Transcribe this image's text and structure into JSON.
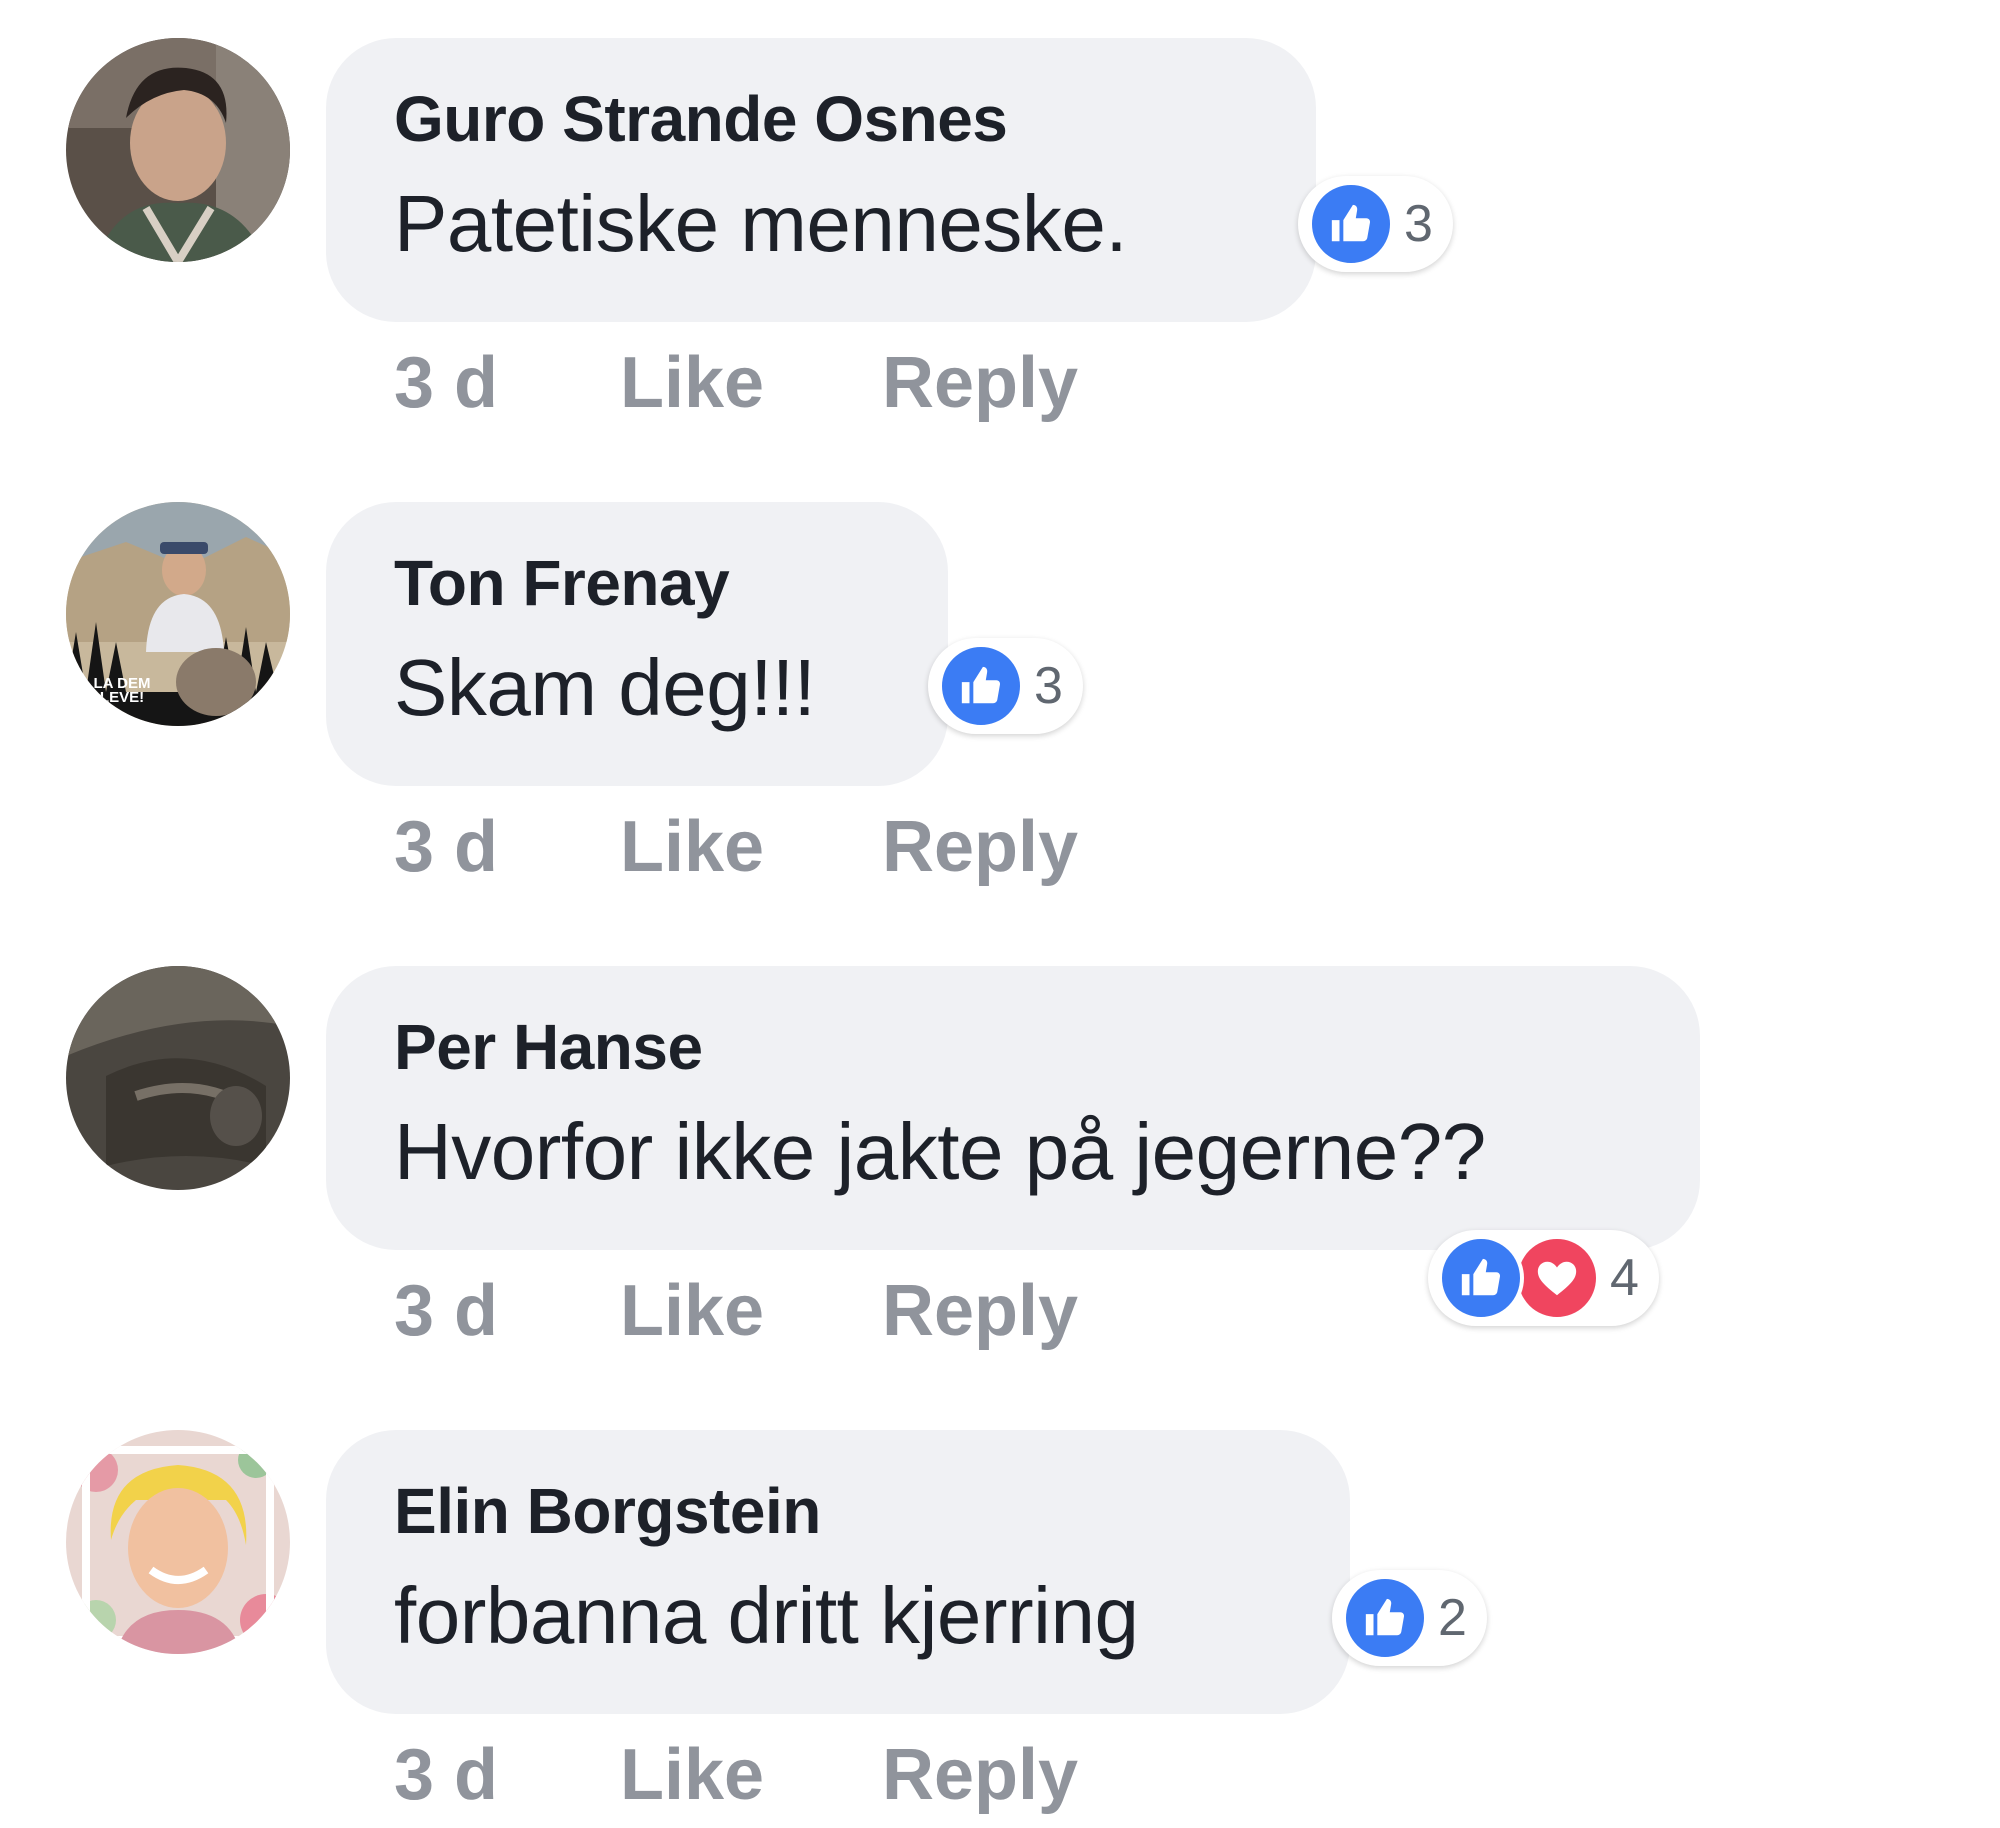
{
  "colors": {
    "bubble": "#f0f1f4",
    "author_text": "#1d2129",
    "meta_text": "#90949c",
    "like_blue": "#3b7cf4",
    "love_red": "#f0455f"
  },
  "comments": [
    {
      "author": "Guro Strande Osnes",
      "text": "Patetiske menneske.",
      "time": "3 d",
      "like_label": "Like",
      "reply_label": "Reply",
      "reactions": {
        "types": [
          "like-icon"
        ],
        "count": "3"
      }
    },
    {
      "author": "Ton Frenay",
      "text": "Skam deg!!!",
      "time": "3 d",
      "like_label": "Like",
      "reply_label": "Reply",
      "avatar_caption": "LA DEM LEVE!",
      "reactions": {
        "types": [
          "like-icon"
        ],
        "count": "3"
      }
    },
    {
      "author": "Per Hanse",
      "text": "Hvorfor ikke jakte på jegerne??",
      "time": "3 d",
      "like_label": "Like",
      "reply_label": "Reply",
      "reactions": {
        "types": [
          "like-icon",
          "heart-icon"
        ],
        "count": "4"
      }
    },
    {
      "author": "Elin Borgstein",
      "text": "forbanna dritt kjerring",
      "time": "3 d",
      "like_label": "Like",
      "reply_label": "Reply",
      "reactions": {
        "types": [
          "like-icon"
        ],
        "count": "2"
      }
    }
  ]
}
